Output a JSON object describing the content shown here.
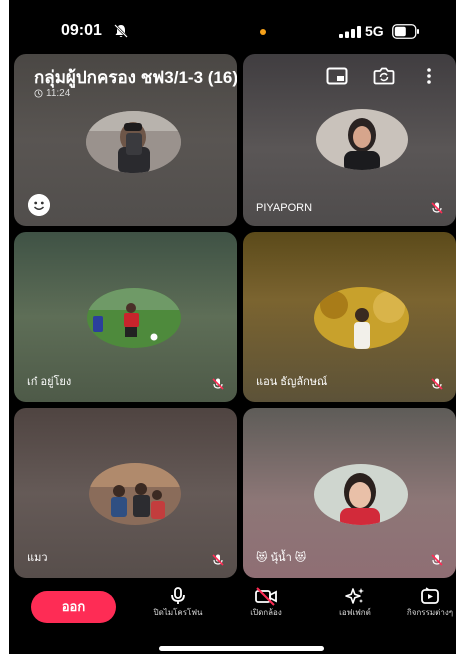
{
  "status_bar": {
    "time": "09:01",
    "network": "5G",
    "icons": [
      "bell-off-icon",
      "mic-in-use-dot",
      "signal-icon",
      "battery-icon"
    ]
  },
  "call": {
    "group_title": "กลุ่มผู้ปกครอง ชฟ3/1-3 (16)",
    "duration": "11:24",
    "header_icons": [
      "pip-icon",
      "flip-camera-icon",
      "more-icon"
    ]
  },
  "participants": [
    {
      "name": "",
      "muted": false,
      "is_self": true
    },
    {
      "name": "PIYAPORN",
      "muted": true
    },
    {
      "name": "เก๋ อยู่โยง",
      "muted": true
    },
    {
      "name": "แอน ธัญลักษณ์",
      "muted": true
    },
    {
      "name": "แมว",
      "muted": true
    },
    {
      "name": "😻 นุ้น้ำ 😻",
      "muted": true
    }
  ],
  "toolbar": {
    "leave_label": "ออก",
    "mic_label": "ปิดไมโครโฟน",
    "camera_label": "เปิดกล้อง",
    "effects_label": "เอฟเฟกต์",
    "activities_label": "กิจกรรมต่างๆ"
  },
  "colors": {
    "accent": "#fe2c55",
    "background": "#000000",
    "mic_dot": "#f6a11a"
  }
}
